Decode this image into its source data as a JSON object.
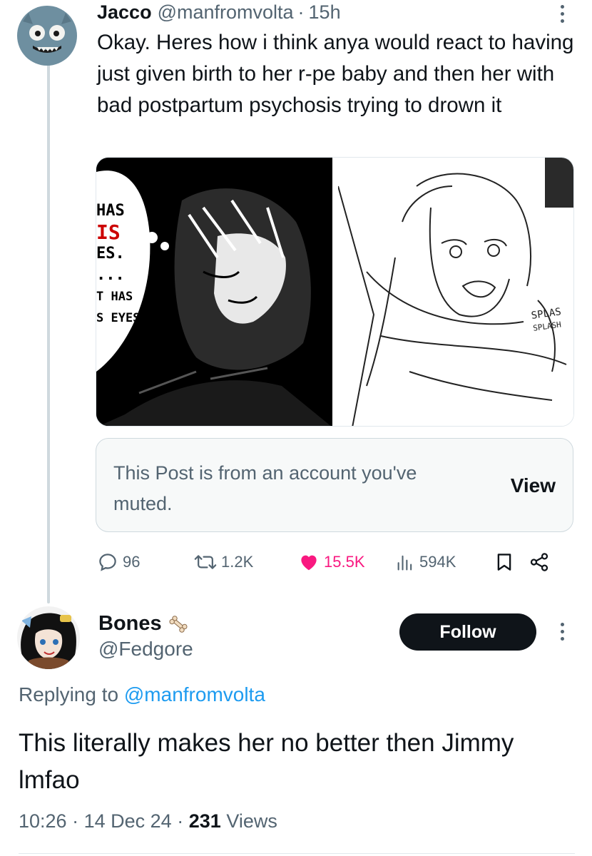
{
  "post": {
    "author_name": "Jacco",
    "handle": "@manfromvolta",
    "separator": "·",
    "time": "15h",
    "text": "Okay. Heres how i think anya would react to having just given birth to her r-pe baby and then her with bad postpartum psychosis trying to drown it",
    "media": {
      "left_panel_lines": [
        "HAS",
        "IS",
        "ES.",
        "...",
        "T HAS",
        "S EYES."
      ],
      "right_panel_sfx": [
        "SPLAS",
        "SPLASH"
      ]
    },
    "muted_notice": {
      "text": "This Post is from an account you've muted.",
      "button_label": "View"
    },
    "actions": {
      "replies": "96",
      "reposts": "1.2K",
      "likes": "15.5K",
      "views": "594K"
    },
    "colors": {
      "like": "#f91880",
      "muted_text": "#536471",
      "thread_line": "#cfd9de"
    }
  },
  "reply": {
    "author_name": "Bones",
    "name_emoji": "bone-icon",
    "handle": "@Fedgore",
    "follow_label": "Follow",
    "replying_prefix": "Replying to",
    "replying_mention": "@manfromvolta",
    "text": "This literally makes her no better then Jimmy lmfao",
    "time": "10:26",
    "date": "14 Dec 24",
    "dot": "·",
    "views_count": "231",
    "views_label": "Views",
    "colors": {
      "mention": "#1d9bf0",
      "follow_bg": "#0f1419"
    }
  }
}
